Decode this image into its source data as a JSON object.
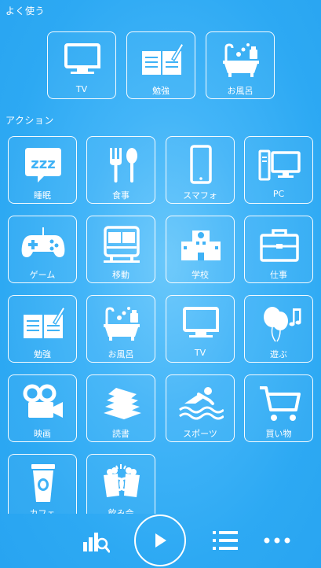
{
  "favorites": {
    "title": "よく使う",
    "items": [
      {
        "label": "TV",
        "icon": "tv-icon"
      },
      {
        "label": "勉強",
        "icon": "study-book-icon"
      },
      {
        "label": "お風呂",
        "icon": "bath-icon"
      }
    ]
  },
  "actions": {
    "title": "アクション",
    "items": [
      {
        "label": "睡眠",
        "icon": "sleep-zzz-icon"
      },
      {
        "label": "食事",
        "icon": "fork-spoon-icon"
      },
      {
        "label": "スマフォ",
        "icon": "smartphone-icon"
      },
      {
        "label": "PC",
        "icon": "desktop-pc-icon"
      },
      {
        "label": "ゲーム",
        "icon": "gamepad-icon"
      },
      {
        "label": "移動",
        "icon": "train-icon"
      },
      {
        "label": "学校",
        "icon": "school-icon"
      },
      {
        "label": "仕事",
        "icon": "briefcase-icon"
      },
      {
        "label": "勉強",
        "icon": "study-book-icon"
      },
      {
        "label": "お風呂",
        "icon": "bath-icon"
      },
      {
        "label": "TV",
        "icon": "tv-icon"
      },
      {
        "label": "遊ぶ",
        "icon": "balloons-icon"
      },
      {
        "label": "映画",
        "icon": "movie-camera-icon"
      },
      {
        "label": "読書",
        "icon": "books-icon"
      },
      {
        "label": "スポーツ",
        "icon": "swimmer-icon"
      },
      {
        "label": "買い物",
        "icon": "shopping-cart-icon"
      },
      {
        "label": "カフェ",
        "icon": "coffee-cup-icon"
      },
      {
        "label": "飲み会",
        "icon": "beer-toast-icon"
      }
    ]
  },
  "bottom_bar": {
    "buttons": [
      {
        "name": "stats",
        "icon": "stats-chart-icon"
      },
      {
        "name": "play",
        "icon": "play-icon"
      },
      {
        "name": "list",
        "icon": "list-icon"
      },
      {
        "name": "more",
        "icon": "more-dots-icon"
      }
    ]
  },
  "colors": {
    "background": "#2daaf3",
    "foreground": "#ffffff"
  }
}
